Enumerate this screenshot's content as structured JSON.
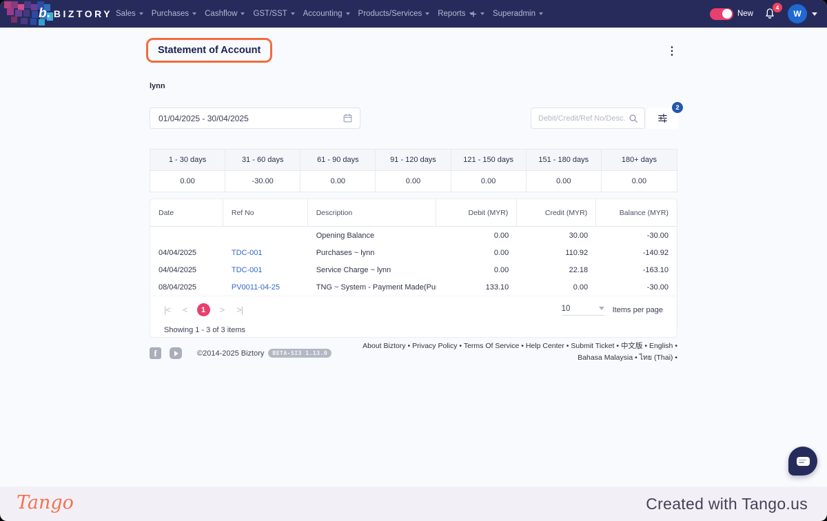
{
  "navbar": {
    "brand": "BIZTORY",
    "brand_mark": "b",
    "brand_mark_dot": ".",
    "menus": [
      "Sales",
      "Purchases",
      "Cashflow",
      "GST/SST",
      "Accounting",
      "Products/Services",
      "Reports"
    ],
    "plus_label": "+",
    "superadmin_label": "Superadmin",
    "toggle_label": "New",
    "notification_count": "4",
    "avatar_initial": "W"
  },
  "page": {
    "title": "Statement of Account",
    "customer_name": "lynn",
    "kebab_icon": "⋮"
  },
  "filters": {
    "date_range": "01/04/2025 - 30/04/2025",
    "search_placeholder": "Debit/Credit/Ref No/Desc.",
    "filter_count": "2"
  },
  "aging": {
    "headers": [
      "1 - 30 days",
      "31 - 60 days",
      "61 - 90 days",
      "91 - 120 days",
      "121 - 150 days",
      "151 - 180 days",
      "180+ days"
    ],
    "values": [
      "0.00",
      "-30.00",
      "0.00",
      "0.00",
      "0.00",
      "0.00",
      "0.00"
    ]
  },
  "table": {
    "headers": [
      "Date",
      "Ref No",
      "Description",
      "Debit (MYR)",
      "Credit (MYR)",
      "Balance (MYR)"
    ],
    "rows": [
      {
        "date": "",
        "ref": "",
        "desc": "Opening Balance",
        "debit": "0.00",
        "credit": "30.00",
        "balance": "-30.00"
      },
      {
        "date": "04/04/2025",
        "ref": "TDC-001",
        "desc": "Purchases ~ lynn",
        "debit": "0.00",
        "credit": "110.92",
        "balance": "-140.92"
      },
      {
        "date": "04/04/2025",
        "ref": "TDC-001",
        "desc": "Service Charge ~ lynn",
        "debit": "0.00",
        "credit": "22.18",
        "balance": "-163.10"
      },
      {
        "date": "08/04/2025",
        "ref": "PV0011-04-25",
        "desc": "TNG ~ System - Payment Made(Purch...",
        "debit": "133.10",
        "credit": "0.00",
        "balance": "-30.00"
      }
    ]
  },
  "pagination": {
    "first_icon": "|<",
    "prev_icon": "<",
    "next_icon": ">",
    "last_icon": ">|",
    "current_page": "1",
    "items_per_page": "10",
    "items_per_page_label": "Items per page",
    "showing_text": "Showing 1 - 3 of 3 items"
  },
  "footer": {
    "facebook_icon": "f",
    "copyright": "©2014-2025 Biztory",
    "version_badge": "BETA-SI3 1.13.0",
    "links_row1": [
      "About Biztory",
      "Privacy Policy",
      "Terms Of Service",
      "Help Center",
      "Submit Ticket",
      "中文版",
      "English"
    ],
    "links_row2": [
      "Bahasa Malaysia",
      "ไทย (Thai)"
    ]
  },
  "tango": {
    "logo": "Tango",
    "credit": "Created with Tango.us"
  },
  "colors": {
    "navbar_bg": "#262b5c",
    "highlight_orange": "#f26b3c",
    "toggle_pink": "#e8406e",
    "notification_red": "#f0415f",
    "avatar_blue": "#2068d2",
    "filter_badge_blue": "#2257ad",
    "link_blue": "#3168c4",
    "page_circle_pink": "#e8406e"
  }
}
